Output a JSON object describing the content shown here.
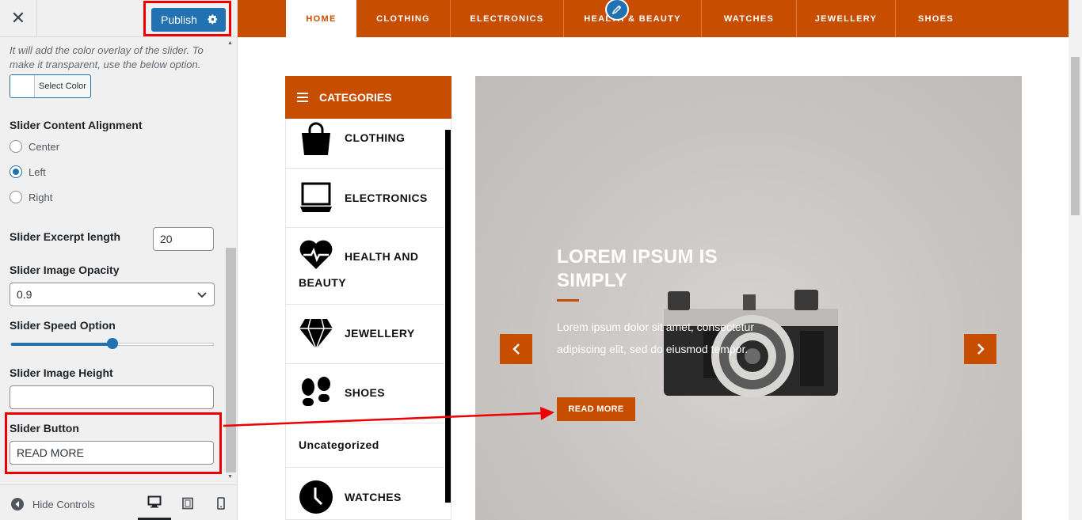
{
  "sidebar": {
    "close_glyph": "✕",
    "publish_label": "Publish",
    "description": "It will add the color overlay of the slider. To make it transparent, use the below option.",
    "color_button_label": "Select Color",
    "alignment": {
      "title": "Slider Content Alignment",
      "options": [
        "Center",
        "Left",
        "Right"
      ],
      "selected": "Left"
    },
    "excerpt": {
      "title": "Slider Excerpt length",
      "value": "20"
    },
    "opacity": {
      "title": "Slider Image Opacity",
      "value": "0.9"
    },
    "speed": {
      "title": "Slider Speed Option",
      "level": 0.5
    },
    "image_height": {
      "title": "Slider Image Height",
      "value": ""
    },
    "button": {
      "title": "Slider Button",
      "value": "READ MORE"
    },
    "footer": {
      "hide_controls_label": "Hide Controls"
    }
  },
  "preview": {
    "nav": [
      "HOME",
      "CLOTHING",
      "ELECTRONICS",
      "HEALTH & BEAUTY",
      "WATCHES",
      "JEWELLERY",
      "SHOES"
    ],
    "categories": {
      "header": "CATEGORIES",
      "items": [
        {
          "label": "CLOTHING",
          "icon": "shopping-bag-icon"
        },
        {
          "label": "ELECTRONICS",
          "icon": "laptop-icon"
        },
        {
          "label": "HEALTH AND",
          "label2": "BEAUTY",
          "icon": "heartbeat-icon"
        },
        {
          "label": "JEWELLERY",
          "icon": "diamond-icon"
        },
        {
          "label": "SHOES",
          "icon": "footprints-icon"
        },
        {
          "label": "Uncategorized",
          "icon": ""
        },
        {
          "label": "WATCHES",
          "icon": "clock-icon"
        }
      ]
    },
    "slide": {
      "title": "LOREM IPSUM IS SIMPLY",
      "text": "Lorem ipsum dolor sit amet, consectetur adipiscing elit, sed do eiusmod tempor.",
      "button": "READ MORE"
    }
  },
  "colors": {
    "brand_orange": "#c74d00",
    "wp_blue": "#2271b1",
    "annotation_red": "#e00000"
  }
}
